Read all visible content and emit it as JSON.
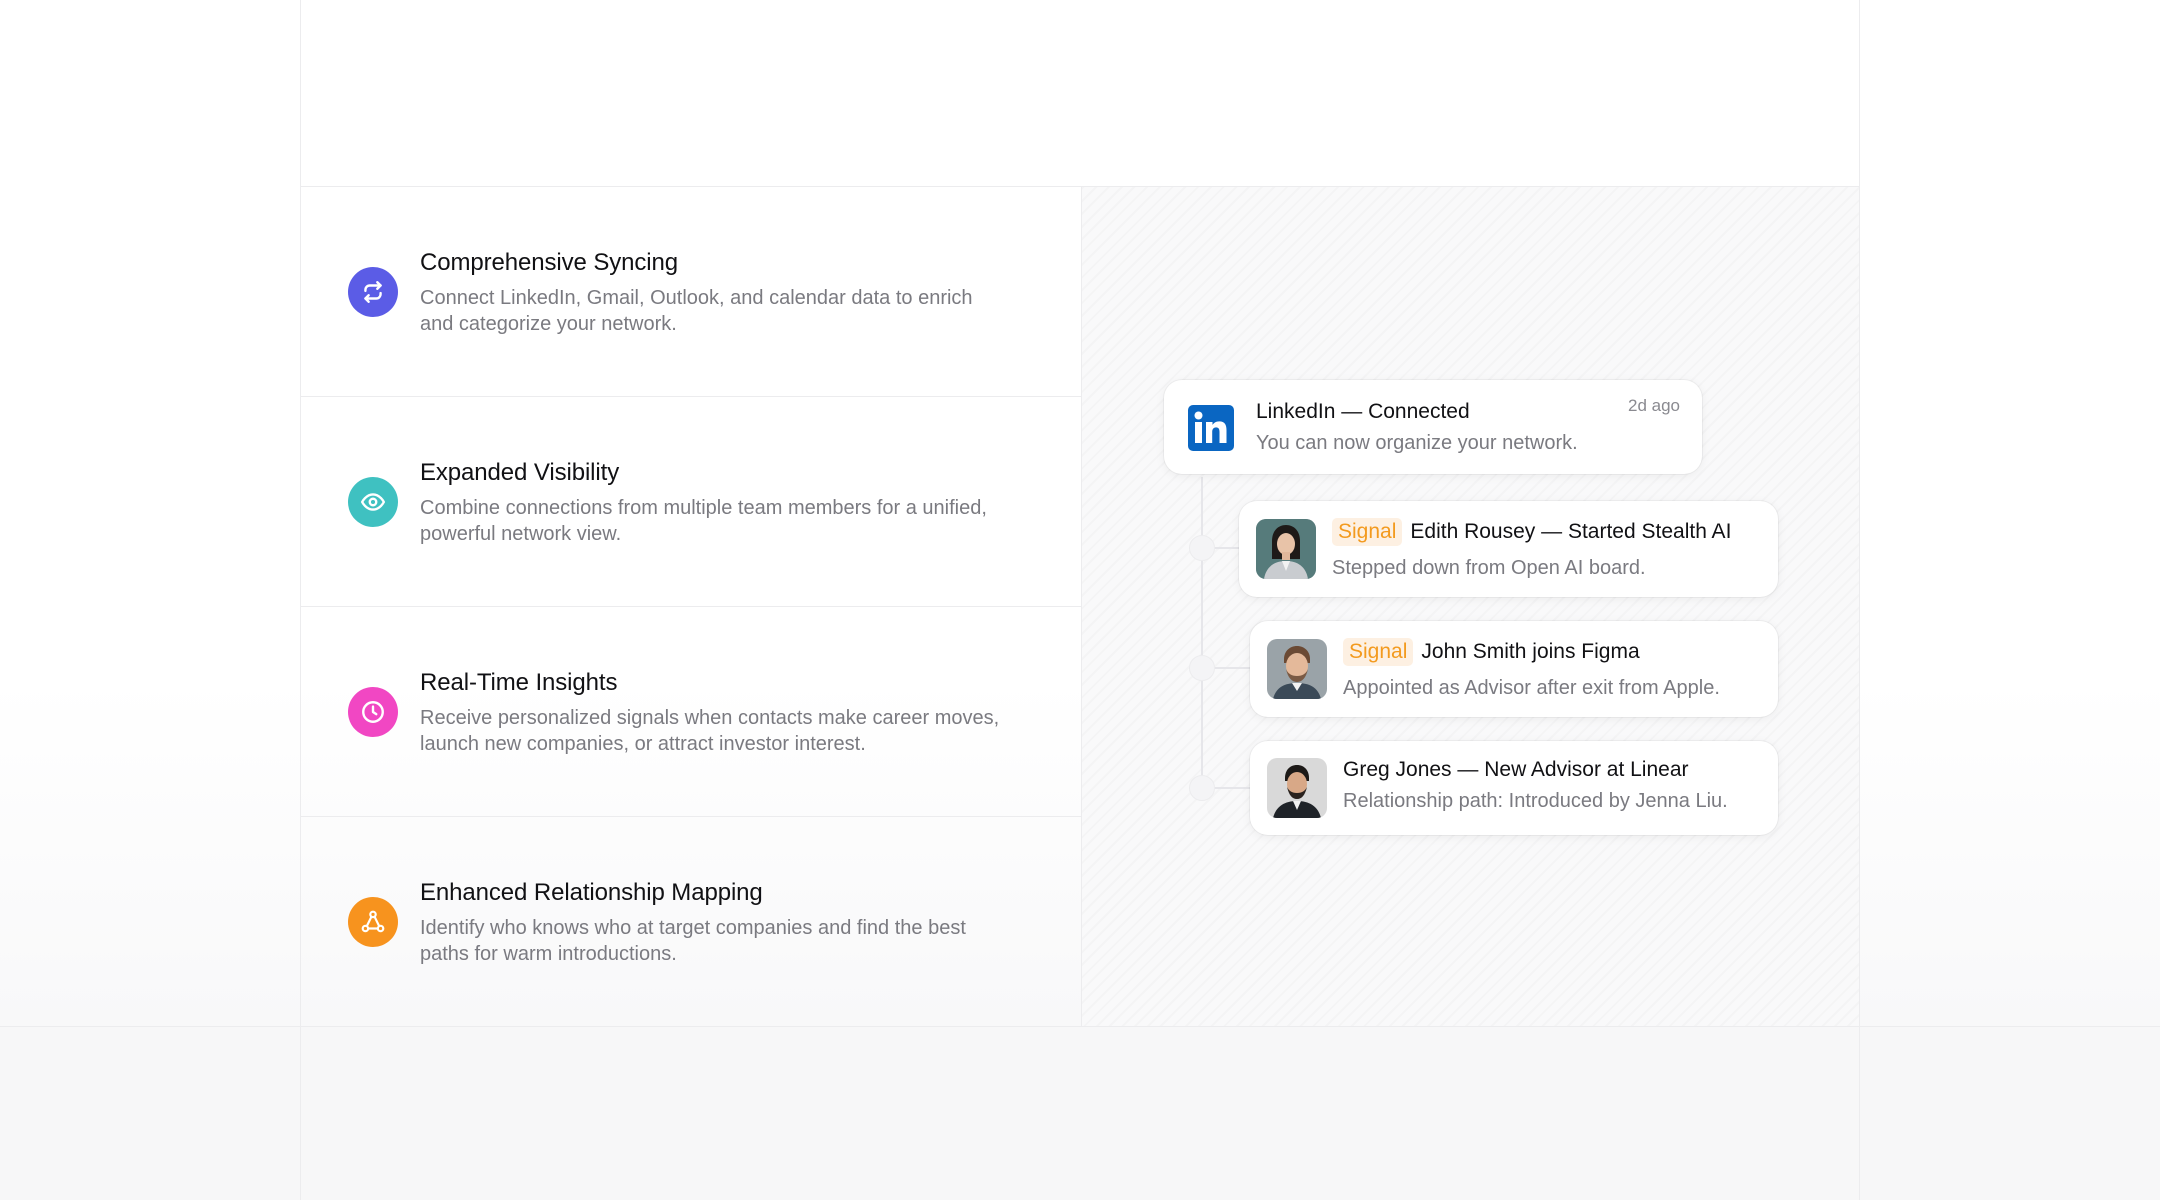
{
  "features": [
    {
      "title": "Comprehensive Syncing",
      "desc": "Connect LinkedIn, Gmail, Outlook, and calendar data to enrich and categorize your network.",
      "icon": "sync-icon",
      "color": "#5b5ce6"
    },
    {
      "title": "Expanded Visibility",
      "desc": "Combine connections from multiple team members for a unified, powerful network view.",
      "icon": "eye-icon",
      "color": "#3fc1c1"
    },
    {
      "title": "Real-Time Insights",
      "desc": "Receive personalized signals when contacts make career moves, launch new companies, or attract investor interest.",
      "icon": "clock-icon",
      "color": "#f147c3"
    },
    {
      "title": "Enhanced Relationship Mapping",
      "desc": "Identify who knows who at target companies and find the best paths for warm introductions.",
      "icon": "network-icon",
      "color": "#f7931e"
    }
  ],
  "notifications": {
    "linkedin": {
      "title": "LinkedIn — Connected",
      "subtitle": "You can now organize your network.",
      "time": "2d ago",
      "icon": "linkedin-icon",
      "color": "#0a66c2"
    },
    "items": [
      {
        "badge": "Signal",
        "title": "Edith Rousey — Started Stealth AI",
        "subtitle": "Stepped down from Open AI board."
      },
      {
        "badge": "Signal",
        "title": "John Smith joins Figma",
        "subtitle": "Appointed as Advisor after exit from Apple."
      },
      {
        "badge": "",
        "title": "Greg Jones — New Advisor at Linear",
        "subtitle": "Relationship path: Introduced by Jenna Liu."
      }
    ]
  },
  "colors": {
    "signal_text": "#f39a1e",
    "signal_bg": "#fdf0e2"
  }
}
